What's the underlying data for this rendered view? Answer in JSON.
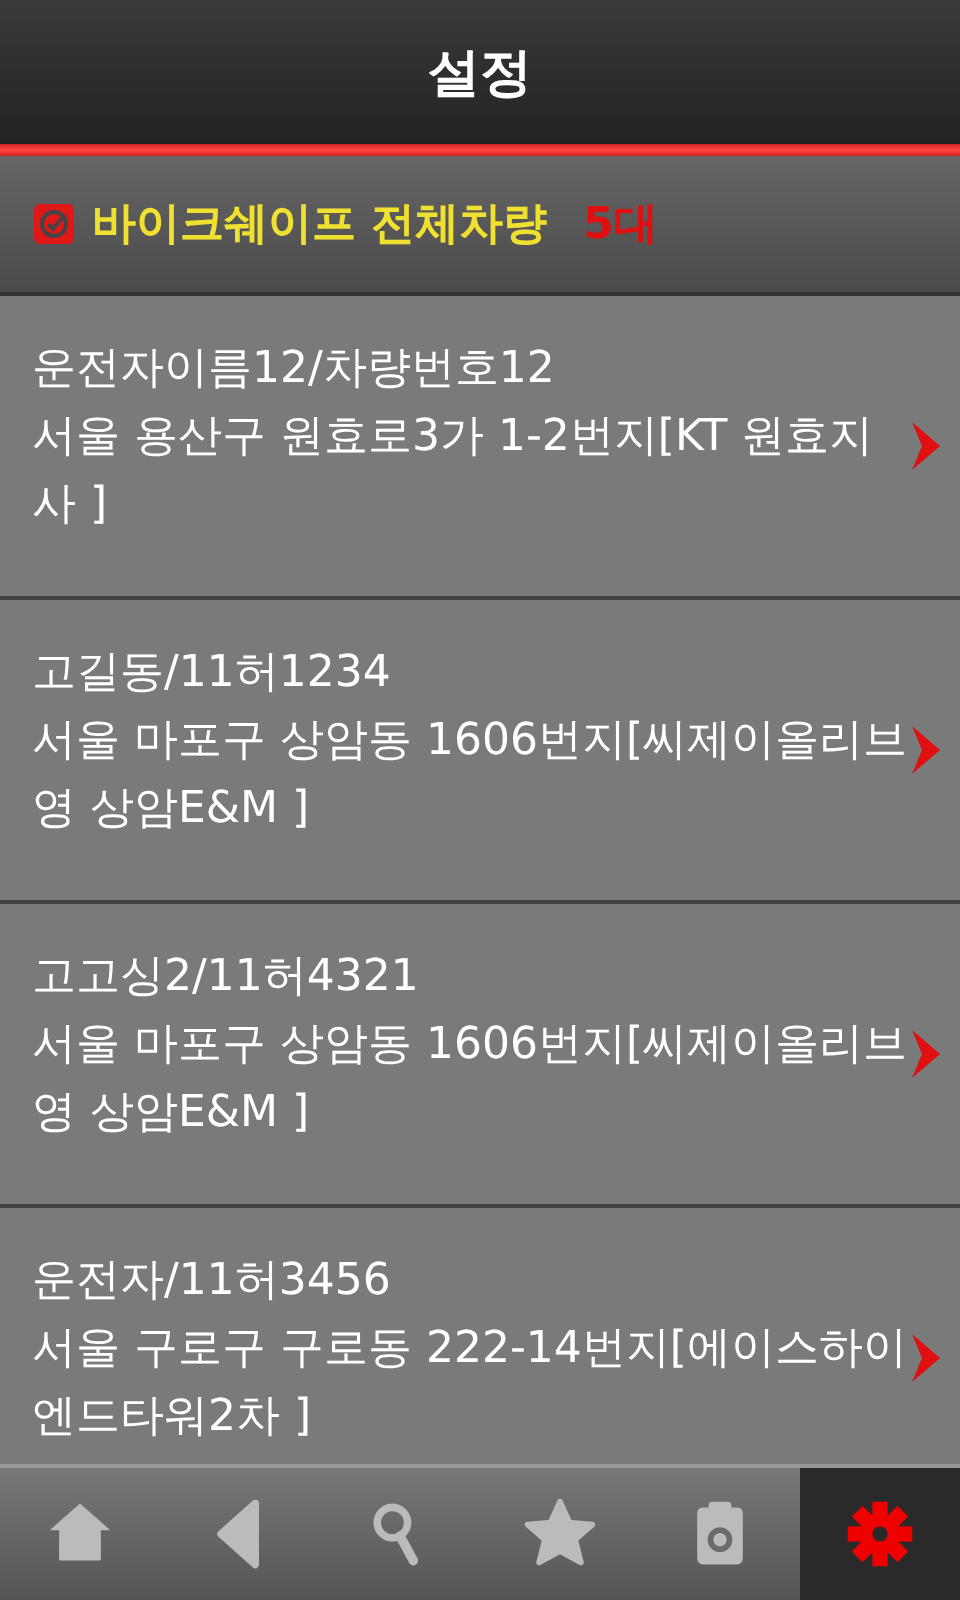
{
  "title": "설정",
  "group": {
    "checked": true,
    "label": "바이크쉐이프 전체차량",
    "count": "5대"
  },
  "vehicles": [
    {
      "name": "운전자이름12/차량번호12",
      "address": "서울 용산구 원효로3가 1-2번지[KT 원효지사 ]"
    },
    {
      "name": "고길동/11허1234",
      "address": "서울 마포구 상암동 1606번지[씨제이올리브영 상암E&M ]"
    },
    {
      "name": "고고싱2/11허4321",
      "address": "서울 마포구 상암동 1606번지[씨제이올리브영 상암E&M ]"
    },
    {
      "name": "운전자/11허3456",
      "address": "서울 구로구 구로동 222-14번지[에이스하이엔드타워2차 ]"
    }
  ],
  "tabs": [
    {
      "kind": "home",
      "selected": false
    },
    {
      "kind": "back",
      "selected": false
    },
    {
      "kind": "search",
      "selected": false
    },
    {
      "kind": "favorite",
      "selected": false
    },
    {
      "kind": "clipboard",
      "selected": false
    },
    {
      "kind": "settings",
      "selected": true
    }
  ]
}
